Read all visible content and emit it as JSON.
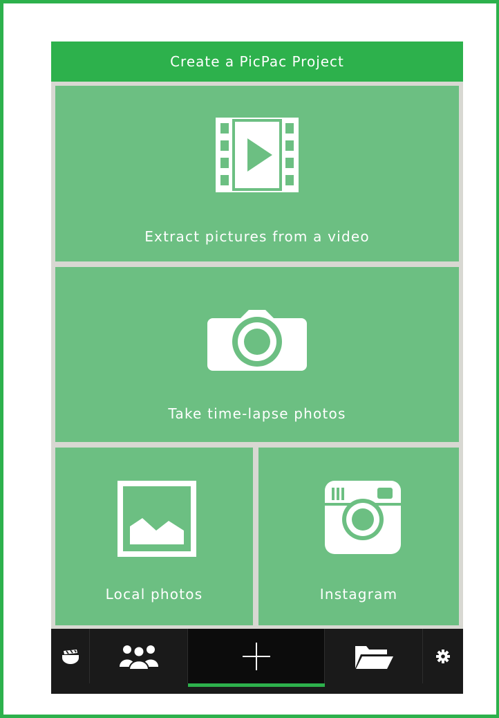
{
  "header": {
    "title": "Create a PicPac Project"
  },
  "options": {
    "video": {
      "label": "Extract pictures from a video",
      "icon": "film-strip-play-icon"
    },
    "timelapse": {
      "label": "Take time-lapse photos",
      "icon": "camera-icon"
    },
    "local": {
      "label": "Local photos",
      "icon": "picture-landscape-icon"
    },
    "instagram": {
      "label": "Instagram",
      "icon": "instagram-camera-icon"
    }
  },
  "tabbar": {
    "tabs": [
      {
        "id": "projects",
        "icon": "clapperboard-icon",
        "active": false
      },
      {
        "id": "community",
        "icon": "people-icon",
        "active": false
      },
      {
        "id": "create",
        "icon": "plus-icon",
        "active": true
      },
      {
        "id": "files",
        "icon": "folder-icon",
        "active": false
      },
      {
        "id": "settings",
        "icon": "gear-icon",
        "active": false
      }
    ]
  },
  "colors": {
    "accent": "#2db14c",
    "tile": "#6cbf82",
    "tabbar": "#1a1a1a",
    "divider": "#d8d8d2"
  }
}
